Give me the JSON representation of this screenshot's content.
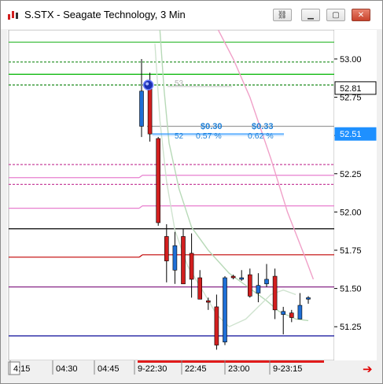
{
  "window": {
    "title": "S.STX - Seagate Technology, 3 Min",
    "buttons": [
      "link-icon",
      "minimize-icon",
      "restore-icon",
      "close-icon"
    ]
  },
  "chart_data": {
    "type": "candlestick",
    "title": "S.STX - Seagate Technology, 3 Min",
    "ylim": [
      51.03,
      53.19
    ],
    "yticks": [
      {
        "value": 53.0,
        "label": "53.00"
      },
      {
        "value": 52.75,
        "label": "52.75"
      },
      {
        "value": 52.5,
        "label": "52.50"
      },
      {
        "value": 52.25,
        "label": "52.25"
      },
      {
        "value": 52.0,
        "label": "52.00"
      },
      {
        "value": 51.75,
        "label": "51.75"
      },
      {
        "value": 51.5,
        "label": "51.50"
      },
      {
        "value": 51.25,
        "label": "51.25"
      }
    ],
    "xticks": [
      "4:15",
      "04:30",
      "04:45",
      "9-22:30",
      "22:45",
      "23:00",
      "9-23:15"
    ],
    "price_markers": [
      {
        "value": 52.81,
        "label": "52.81",
        "color": "#ffffff",
        "text_color": "#000000"
      },
      {
        "value": 52.51,
        "label": "52.51",
        "color": "#1e90ff",
        "text_color": "#ffffff"
      }
    ],
    "colors": {
      "up": "#1f6fd6",
      "down": "#d21f1f",
      "axis_bottom_highlight": "#e01b1b",
      "measure_text": "#1e7fd6",
      "arrow": "#e00000"
    },
    "candles": [
      {
        "x": 0,
        "open": 52.56,
        "high": 53.0,
        "low": 52.49,
        "close": 52.79
      },
      {
        "x": 1,
        "open": 52.82,
        "high": 52.91,
        "low": 52.46,
        "close": 52.51
      },
      {
        "x": 2,
        "open": 52.48,
        "high": 52.49,
        "low": 51.91,
        "close": 51.93
      },
      {
        "x": 3,
        "open": 51.84,
        "high": 51.92,
        "low": 51.54,
        "close": 51.68
      },
      {
        "x": 4,
        "open": 51.62,
        "high": 51.87,
        "low": 51.53,
        "close": 51.78
      },
      {
        "x": 5,
        "open": 51.84,
        "high": 51.89,
        "low": 51.55,
        "close": 51.53
      },
      {
        "x": 6,
        "open": 51.73,
        "high": 51.86,
        "low": 51.44,
        "close": 51.56
      },
      {
        "x": 7,
        "open": 51.57,
        "high": 51.62,
        "low": 51.43,
        "close": 51.43
      },
      {
        "x": 8,
        "open": 51.42,
        "high": 51.44,
        "low": 51.36,
        "close": 51.41
      },
      {
        "x": 9,
        "open": 51.38,
        "high": 51.46,
        "low": 51.1,
        "close": 51.13
      },
      {
        "x": 10,
        "open": 51.15,
        "high": 51.58,
        "low": 51.13,
        "close": 51.57
      },
      {
        "x": 11,
        "open": 51.58,
        "high": 51.59,
        "low": 51.56,
        "close": 51.57
      },
      {
        "x": 12,
        "open": 51.56,
        "high": 51.62,
        "low": 51.55,
        "close": 51.57
      },
      {
        "x": 13,
        "open": 51.59,
        "high": 51.63,
        "low": 51.44,
        "close": 51.45
      },
      {
        "x": 14,
        "open": 51.47,
        "high": 51.6,
        "low": 51.41,
        "close": 51.52
      },
      {
        "x": 15,
        "open": 51.53,
        "high": 51.66,
        "low": 51.51,
        "close": 51.56
      },
      {
        "x": 16,
        "open": 51.58,
        "high": 51.63,
        "low": 51.3,
        "close": 51.36
      },
      {
        "x": 17,
        "open": 51.33,
        "high": 51.38,
        "low": 51.2,
        "close": 51.35
      },
      {
        "x": 18,
        "open": 51.34,
        "high": 51.36,
        "low": 51.28,
        "close": 51.31
      },
      {
        "x": 19,
        "open": 51.3,
        "high": 51.47,
        "low": 51.3,
        "close": 51.39
      },
      {
        "x": 20,
        "open": 51.43,
        "high": 51.45,
        "low": 51.4,
        "close": 51.44
      }
    ],
    "levels": [
      {
        "value": 53.11,
        "color": "#2db82d",
        "style": "solid"
      },
      {
        "value": 52.98,
        "color": "#1a8a1a",
        "style": "dashed"
      },
      {
        "value": 52.9,
        "color": "#00b400",
        "style": "solid"
      },
      {
        "value": 52.83,
        "color": "#1a8a1a",
        "style": "dashed"
      },
      {
        "value": 52.56,
        "color": "#9c9c9c",
        "style": "solid"
      },
      {
        "value": 52.31,
        "color": "#c8449e",
        "style": "dashed"
      },
      {
        "value": 52.24,
        "color": "#e87fcf",
        "style": "solid"
      },
      {
        "value": 52.18,
        "color": "#c8449e",
        "style": "dashed"
      },
      {
        "value": 52.04,
        "color": "#e87fcf",
        "style": "solid"
      },
      {
        "value": 51.89,
        "color": "#000000",
        "style": "solid"
      },
      {
        "value": 51.72,
        "color": "#c00000",
        "style": "solid"
      },
      {
        "value": 51.51,
        "color": "#7a0f7a",
        "style": "solid"
      },
      {
        "value": 51.19,
        "color": "#0c0c9a",
        "style": "solid"
      }
    ],
    "moving_averages": [
      {
        "color": "#b7d9b7",
        "points": [
          [
            2.2,
            53.19
          ],
          [
            2.7,
            52.8
          ],
          [
            3.3,
            52.45
          ],
          [
            4.5,
            52.15
          ],
          [
            6,
            51.9
          ],
          [
            8,
            51.75
          ],
          [
            10.5,
            51.6
          ],
          [
            12.5,
            51.52
          ],
          [
            15,
            51.42
          ],
          [
            16.5,
            51.35
          ],
          [
            18.5,
            51.3
          ],
          [
            20,
            51.29
          ]
        ]
      },
      {
        "color": "#cfe3cf",
        "points": [
          [
            1.6,
            53.1
          ],
          [
            2.2,
            52.6
          ],
          [
            3,
            52.2
          ],
          [
            4,
            51.88
          ],
          [
            5.5,
            51.65
          ],
          [
            7.5,
            51.47
          ],
          [
            9,
            51.33
          ],
          [
            10.5,
            51.25
          ],
          [
            12.5,
            51.3
          ],
          [
            14,
            51.38
          ],
          [
            15.5,
            51.46
          ],
          [
            17,
            51.49
          ],
          [
            18.5,
            51.46
          ]
        ]
      },
      {
        "color": "#f0a0c8",
        "points": [
          [
            9.2,
            53.19
          ],
          [
            11,
            53.0
          ],
          [
            13,
            52.75
          ],
          [
            15.5,
            52.35
          ],
          [
            17.5,
            52.0
          ],
          [
            19.5,
            51.72
          ],
          [
            20.6,
            51.56
          ]
        ]
      }
    ],
    "measurements": [
      {
        "value": "$0.30",
        "percent": "0.57 %"
      },
      {
        "value": "$0.33",
        "percent": "0.62 %"
      }
    ],
    "annotations": [
      "53",
      "52"
    ]
  }
}
